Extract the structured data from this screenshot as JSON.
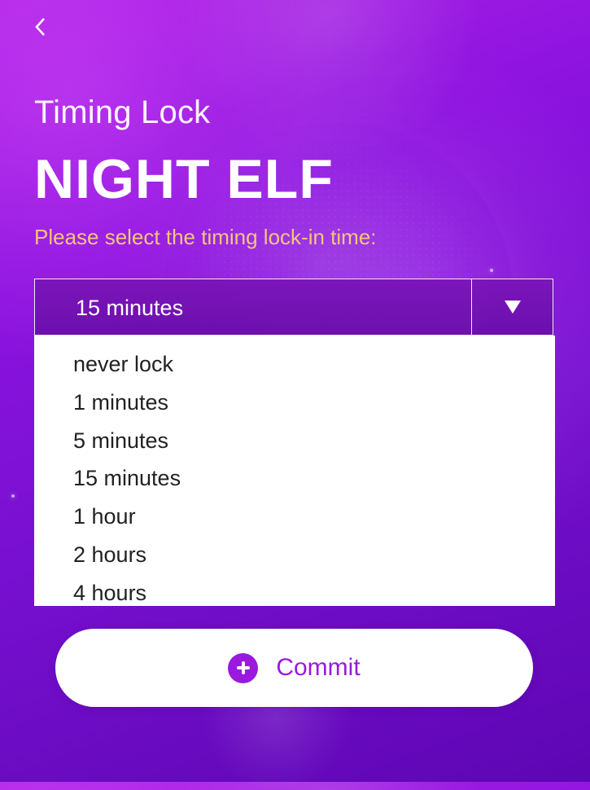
{
  "screen": {
    "title": "Timing Lock",
    "brand": "NIGHT ELF",
    "instruction": "Please select the timing lock-in time:"
  },
  "dropdown": {
    "selected": "15 minutes",
    "toggle_icon": "chevron-down-icon",
    "options": [
      "never lock",
      "1 minutes",
      "5 minutes",
      "15 minutes",
      "1 hour",
      "2 hours",
      "4 hours"
    ]
  },
  "actions": {
    "back_icon": "back-icon",
    "commit_icon": "plus-icon",
    "commit_label": "Commit"
  },
  "colors": {
    "accent_purple": "#9a19dd",
    "instruction_gold": "#f3c57b",
    "background_purple": "#7710d0",
    "white": "#ffffff"
  }
}
